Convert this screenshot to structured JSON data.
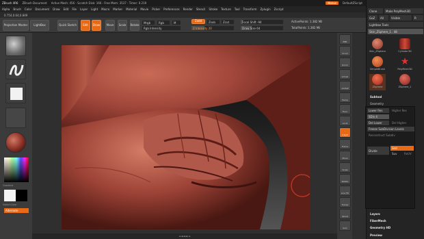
{
  "titlebar": {
    "app": "ZBrush 4R6",
    "doc": "ZBrush Document",
    "mesh_info": "Active Mesh: 456 - Scratch Disk: 166 - Free Mem: 3537 - Timer: 0.219",
    "menus_btn": "Menus",
    "script_btn": "DefaultZScript"
  },
  "menubar": [
    "Alpha",
    "Brush",
    "Color",
    "Document",
    "Draw",
    "Edit",
    "File",
    "Layer",
    "Light",
    "Macro",
    "Marker",
    "Material",
    "Movie",
    "Picker",
    "Preferences",
    "Render",
    "Stencil",
    "Stroke",
    "Texture",
    "Tool",
    "Transform",
    "Zplugin",
    "Zscript"
  ],
  "infobar": "0.754,0.64,0.849",
  "shelf": {
    "projection_master": "Projection Master",
    "lightbox": "LightBox",
    "quick_sketch": "Quick Sketch",
    "edit": "Edit",
    "draw": "Draw",
    "move": "Move",
    "scale": "Scale",
    "rotate": "Rotate",
    "mrgb": "Mrgb",
    "rgb": "Rgb",
    "m": "M",
    "zadd": "Zadd",
    "zsub": "Zsub",
    "zcut": "Zcut",
    "rgb_intensity": "Rgb Intensity",
    "z_intensity": "Z Intensity 20",
    "focal_shift": "Focal Shift -94",
    "draw_size": "Draw Size 64",
    "active_points": "ActivePoints: 1.382 Mil",
    "total_points": "TotalPoints: 1.382 Mil"
  },
  "lefttray": {
    "gradient": "Gradient",
    "switch_color": "SwitchColor",
    "alternate": "Alternate"
  },
  "rightpanel": {
    "clone": "Clone",
    "make_polymesh": "Make PolyMesh3D",
    "goz": "GoZ",
    "all": "All",
    "visible": "Visible",
    "r": "R",
    "lightbox_tools": "Lightbox Tools",
    "tool_name": "Skin_ZSphere_1 . 48",
    "tools": [
      "Skin_ZSphere",
      "Cylinder3D",
      "SimpleBrush",
      "PolyMesh3D",
      "ZSphere",
      "ZSphere_1"
    ],
    "subtool": "Subtool",
    "geometry": "Geometry",
    "lower_res": "Lower Res",
    "higher_res": "Higher Res",
    "sdiv": "SDiv 4",
    "del_lower": "Del Lower",
    "del_higher": "Del Higher",
    "freeze": "Freeze SubDivision Levels",
    "reconstruct": "Reconstruct Subdiv",
    "divide": "Divide",
    "smt": "Smt",
    "suv": "Suv",
    "reuv": "ReUV",
    "edgeloop": "EdgeLoop",
    "crease": "Crease",
    "shadowbox": "ShadowBox",
    "claypolish": "ClayPolish",
    "dynamesh": "DynaMesh",
    "qremesher": "qRemesher",
    "modify_topology": "Modify Topology",
    "meshintegrity": "MeshIntegrity",
    "layers": "Layers",
    "fibermesh": "FiberMesh",
    "geometry_hd": "Geometry HD",
    "preview": "Preview"
  },
  "rightshelf": [
    "BPR",
    "Scroll",
    "Zoom",
    "Actual",
    "AAHalf",
    "Persp",
    "Floor",
    "Local",
    "L.Sym",
    "Frame",
    "Move",
    "Scale",
    "Rotate",
    "Line Fill",
    "Transp",
    "Ghost",
    "Solo"
  ],
  "colors": {
    "accent": "#e86a17",
    "skin": "#9a3a2e"
  },
  "statusbar": "◄ ▬▬▬ ►"
}
